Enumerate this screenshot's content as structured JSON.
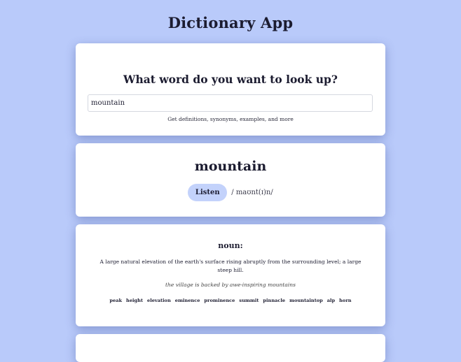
{
  "app": {
    "title": "Dictionary App"
  },
  "search": {
    "heading": "What word do you want to look up?",
    "value": "mountain",
    "hint": "Get definitions, synonyms, examples, and more"
  },
  "word": {
    "text": "mountain",
    "listen_label": "Listen",
    "phonetic": "/ maʊnt(ɪ)n/"
  },
  "meanings": [
    {
      "part_of_speech": "noun:",
      "definition": "A large natural elevation of the earth's surface rising abruptly from the surrounding level; a large steep hill.",
      "example": "the village is backed by awe-inspiring mountains",
      "synonyms": [
        "peak",
        "height",
        "elevation",
        "eminence",
        "prominence",
        "summit",
        "pinnacle",
        "mountaintop",
        "alp",
        "horn"
      ]
    }
  ],
  "colors": {
    "background": "#b9cafa",
    "card": "#ffffff",
    "listen_button": "#c3d2fb"
  }
}
